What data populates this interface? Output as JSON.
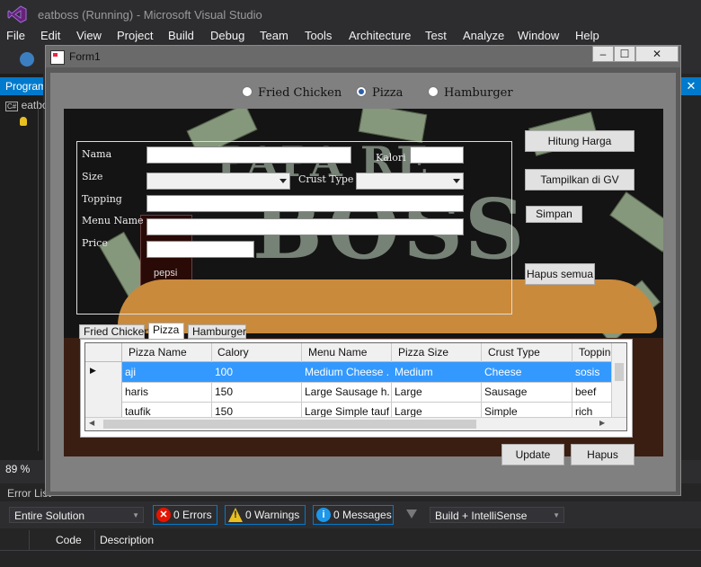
{
  "vs": {
    "title": "eatboss (Running) - Microsoft Visual Studio",
    "menu": [
      "File",
      "Edit",
      "View",
      "Project",
      "Build",
      "Debug",
      "Team",
      "Tools",
      "Architecture",
      "Test",
      "Analyze",
      "Window",
      "Help"
    ],
    "left_panel_header": "Program",
    "left_panel_file": "eatbo",
    "zoom": "89 %",
    "right_close": "✕"
  },
  "error_list": {
    "title": "Error List",
    "scope": "Entire Solution",
    "errors": "0 Errors",
    "warnings": "0 Warnings",
    "messages": "0 Messages",
    "source": "Build + IntelliSense",
    "columns": [
      "Code",
      "Description"
    ]
  },
  "form": {
    "caption": "Form1",
    "radios": [
      {
        "label": "Fried Chicken",
        "checked": false
      },
      {
        "label": "Pizza",
        "checked": true
      },
      {
        "label": "Hamburger",
        "checked": false
      }
    ],
    "labels": {
      "nama": "Nama",
      "kalori": "Kalori",
      "size": "Size",
      "crust_type": "Crust Type",
      "topping": "Topping",
      "menu_name": "Menu Name",
      "price": "Price"
    },
    "buttons": {
      "hitung": "Hitung Harga",
      "tampilkan": "Tampilkan di GV",
      "simpan": "Simpan",
      "hapus_semua": "Hapus semua",
      "update": "Update",
      "hapus": "Hapus"
    },
    "tabs": [
      "Fried Chicken",
      "Pizza",
      "Hamburger"
    ],
    "active_tab": "Pizza",
    "grid": {
      "columns": [
        "Pizza Name",
        "Calory",
        "Menu Name",
        "Pizza Size",
        "Crust Type",
        "Topping"
      ],
      "rows": [
        [
          "aji",
          "100",
          "Medium Cheese ...",
          "Medium",
          "Cheese",
          "sosis"
        ],
        [
          "haris",
          "150",
          "Large Sausage h...",
          "Large",
          "Sausage",
          "beef"
        ],
        [
          "taufik",
          "150",
          "Large Simple tauf...",
          "Large",
          "Simple",
          "rich"
        ]
      ]
    },
    "bg_words": {
      "top": "PAPA RE",
      "main": "BOSS",
      "brand": "pepsi"
    }
  }
}
